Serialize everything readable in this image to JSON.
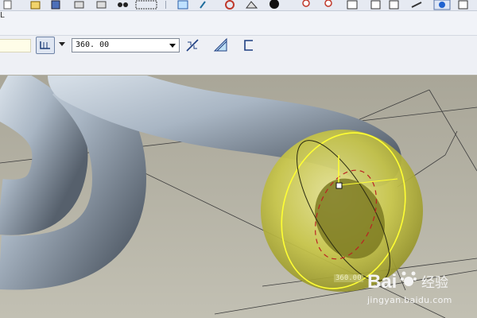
{
  "toolbar": {
    "icons": [
      "new-icon",
      "open-icon",
      "save-icon",
      "print-icon",
      "binoculars-icon",
      "select-box-icon",
      "datum-plane-icon",
      "sketch-icon",
      "spin-icon",
      "view-icon",
      "shade-icon",
      "zoom-in-icon",
      "zoom-out-icon",
      "refit-icon",
      "view-manager-icon",
      "layers-icon",
      "help-icon",
      "more-icon"
    ]
  },
  "dashboard": {
    "corner_label": "L",
    "angle_value": "360. 00",
    "buttons": [
      "flip-direction-icon",
      "remove-material-icon",
      "thicken-icon"
    ]
  },
  "viewport": {
    "dimension_label": "360.00",
    "colors": {
      "background": "#b3b1a5",
      "pipe": "#a9b6c4",
      "sphere": "#c9c74a",
      "highlight": "#ffff33"
    }
  },
  "watermark": {
    "logo_text": "Bai",
    "logo_cn": "经验",
    "url": "jingyan.baidu.com"
  }
}
